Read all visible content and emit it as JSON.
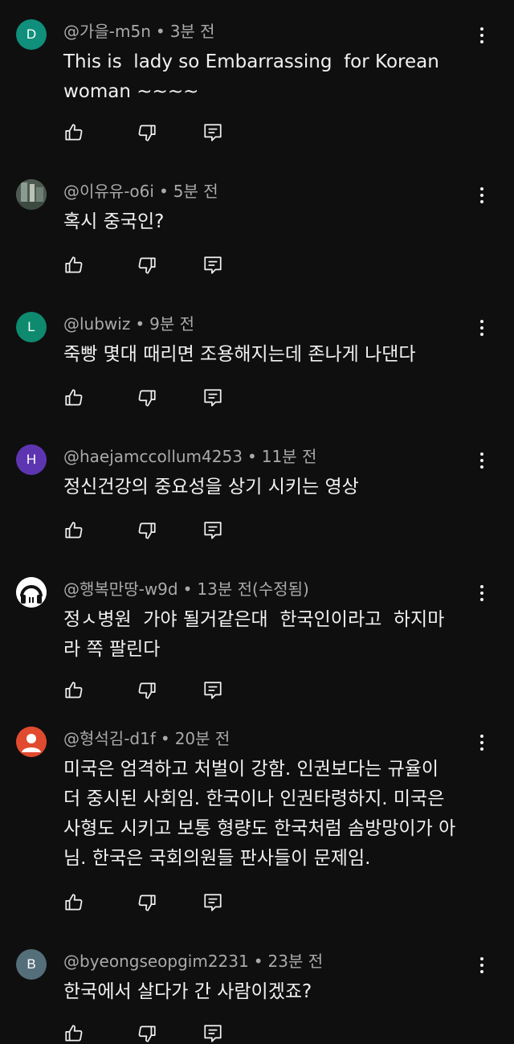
{
  "comments": [
    {
      "author": "@가을-m5n",
      "time": "3분 전",
      "text": "This is  lady so Embarrassing  for Korean\nwoman ~~~~",
      "avatar_letter": "D",
      "avatar_color": "#0f8f7c"
    },
    {
      "author": "@이유유-o6i",
      "time": "5분 전",
      "text": "혹시 중국인?",
      "avatar_letter": "",
      "avatar_color": "#5d6b60"
    },
    {
      "author": "@lubwiz",
      "time": "9분 전",
      "text": "죽빵 몇대 때리면 조용해지는데 존나게 나댄다",
      "avatar_letter": "L",
      "avatar_color": "#0e8a6f"
    },
    {
      "author": "@haejamccollum4253",
      "time": "11분 전",
      "text": "정신건강의 중요성을 상기 시키는 영상",
      "avatar_letter": "H",
      "avatar_color": "#5e35b1"
    },
    {
      "author": "@행복만땅-w9d",
      "time": "13분 전(수정됨)",
      "text": "정ㅅ병원  가야 될거같은대  한국인이라고  하지마\n라 쪽 팔린다",
      "avatar_letter": "",
      "avatar_color": "#ffffff"
    },
    {
      "author": "@형석김-d1f",
      "time": "20분 전",
      "text": "미국은 엄격하고 처벌이 강함. 인권보다는 규율이\n더 중시된 사회임. 한국이나 인권타령하지. 미국은\n사형도 시키고 보통 형량도 한국처럼 솜방망이가 아\n님. 한국은 국회의원들 판사들이 문제임.",
      "avatar_letter": "",
      "avatar_color": "#e04a2f"
    },
    {
      "author": "@byeongseopgim2231",
      "time": "23분 전",
      "text": "한국에서 살다가 간 사람이겠죠?",
      "avatar_letter": "B",
      "avatar_color": "#546e7a"
    }
  ],
  "icons": {
    "like": "thumbs-up-icon",
    "dislike": "thumbs-down-icon",
    "reply": "reply-icon",
    "more": "more-vertical-icon"
  }
}
